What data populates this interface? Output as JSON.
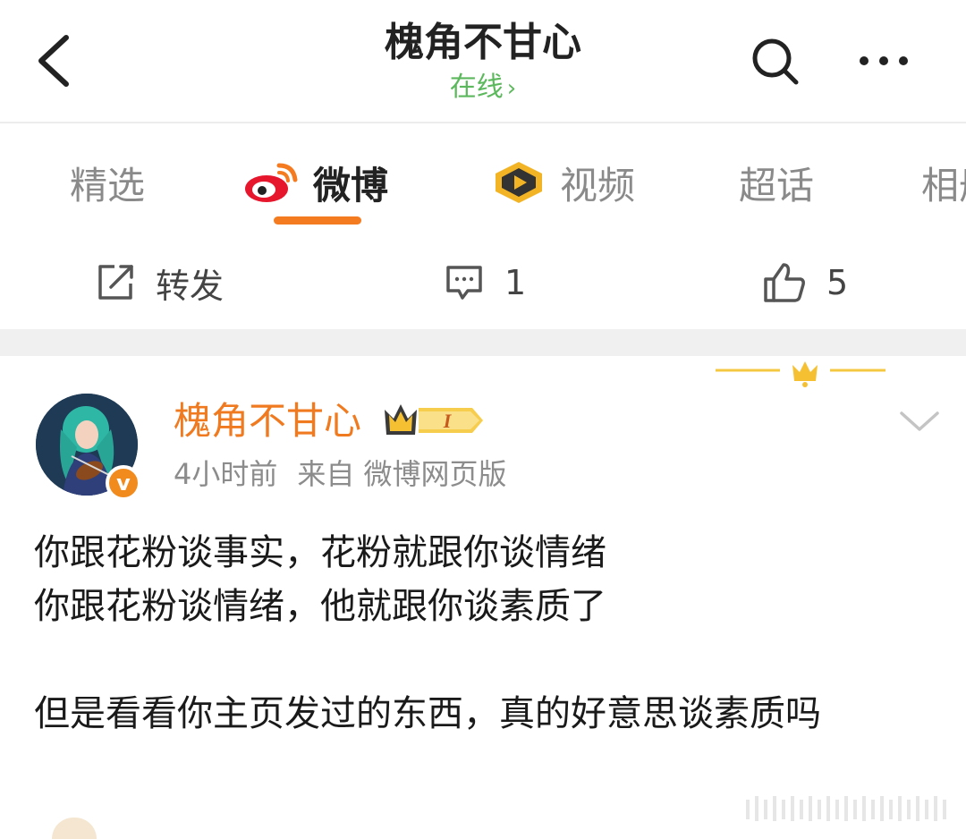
{
  "header": {
    "title": "槐角不甘心",
    "status": "在线",
    "status_chevron": "›"
  },
  "tabs": [
    {
      "label": "精选",
      "active": false
    },
    {
      "label": "微博",
      "active": true
    },
    {
      "label": "视频",
      "active": false
    },
    {
      "label": "超话",
      "active": false
    },
    {
      "label": "相册",
      "active": false
    }
  ],
  "actions": {
    "repost_label": "转发",
    "comment_count": "1",
    "like_count": "5"
  },
  "post": {
    "username": "槐角不甘心",
    "level_badge": "I",
    "verified_badge": "v",
    "time": "4小时前",
    "source": "来自 微博网页版",
    "lines": [
      "你跟花粉谈事实，花粉就跟你谈情绪",
      "你跟花粉谈情绪，他就跟你谈素质了",
      "但是看看你主页发过的东西，真的好意思谈素质吗"
    ]
  },
  "colors": {
    "accent": "#f47b20",
    "online": "#5cb85c",
    "username": "#f07a20",
    "muted": "#8c8c8c"
  },
  "icons": [
    "back-arrow-icon",
    "search-icon",
    "more-icon",
    "weibo-logo-icon",
    "video-play-icon",
    "repost-icon",
    "comment-icon",
    "like-icon",
    "crown-icon",
    "level-badge-icon",
    "verified-icon",
    "chevron-down-icon"
  ]
}
